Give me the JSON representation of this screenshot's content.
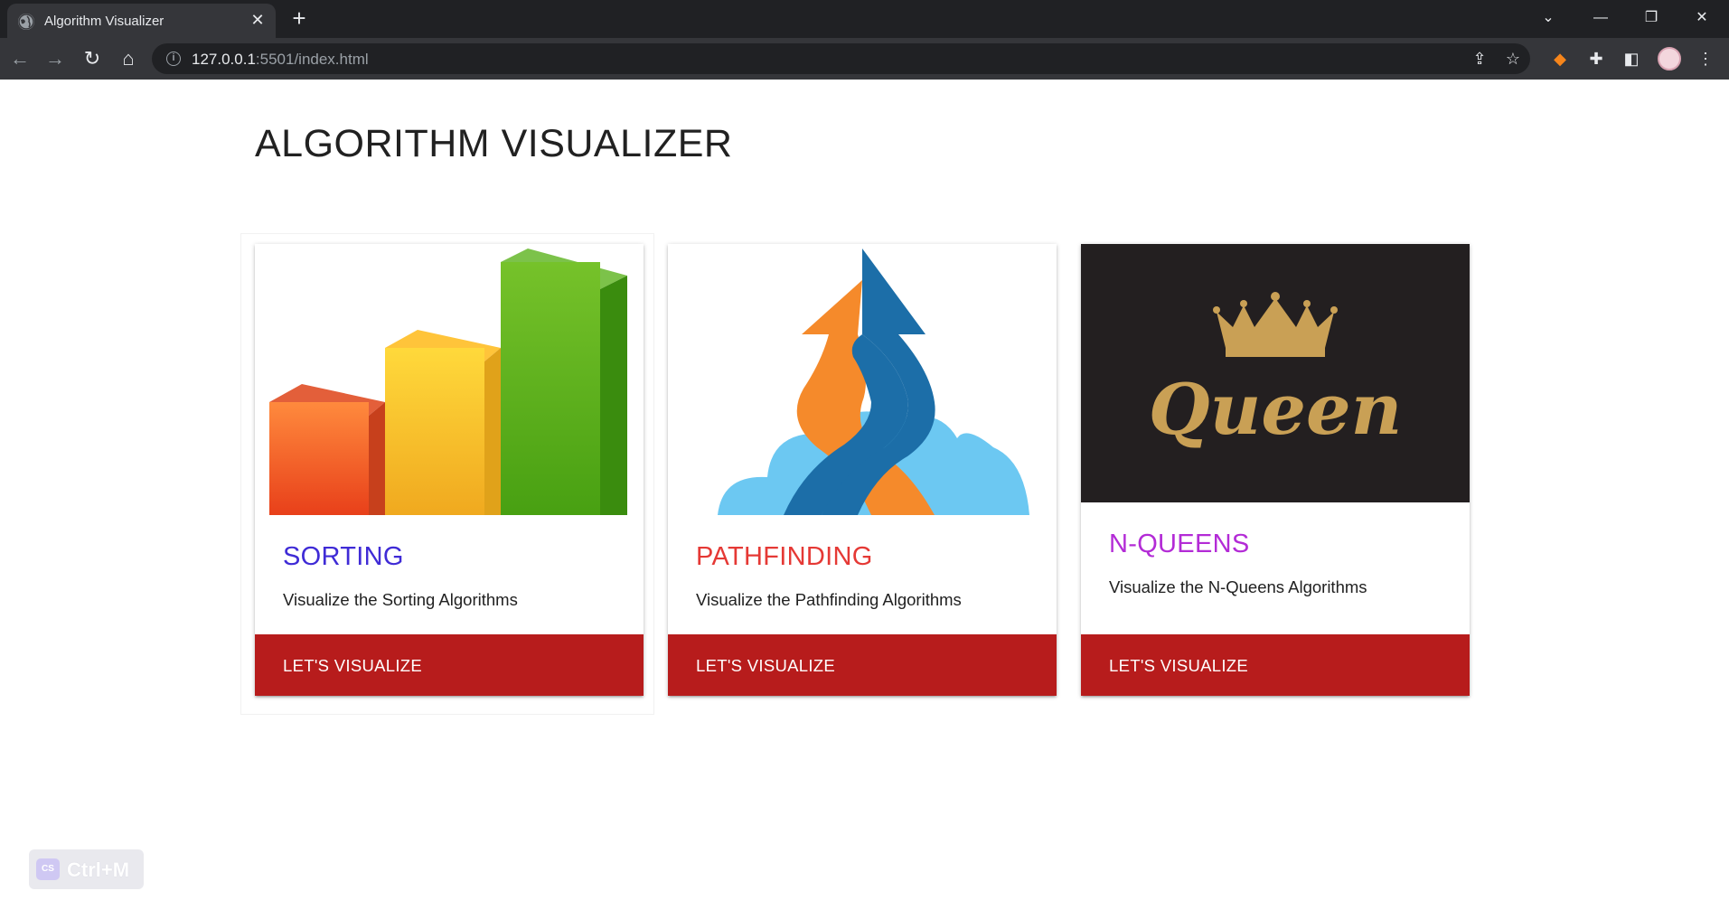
{
  "browser": {
    "tab_title": "Algorithm Visualizer",
    "tab_close": "✕",
    "new_tab": "+",
    "url_host": "127.0.0.1",
    "url_rest": ":5501/index.html"
  },
  "page": {
    "title": "ALGORITHM VISUALIZER"
  },
  "cards": [
    {
      "title": "SORTING",
      "description": "Visualize the Sorting Algorithms",
      "action": "LET'S VISUALIZE",
      "title_color": "#3f2bd6",
      "image": "bar-chart-illustration"
    },
    {
      "title": "PATHFINDING",
      "description": "Visualize the Pathfinding Algorithms",
      "action": "LET'S VISUALIZE",
      "title_color": "#e53935",
      "image": "intertwined-arrows-illustration"
    },
    {
      "title": "N-QUEENS",
      "description": "Visualize the N-Queens Algorithms",
      "action": "LET'S VISUALIZE",
      "title_color": "#b32bd6",
      "image": "queen-crown-illustration"
    }
  ],
  "overlay_badge": {
    "text": "Ctrl+M",
    "logo": "CS"
  },
  "colors": {
    "action_button": "#b71c1c",
    "chrome_dark": "#202124",
    "chrome_mid": "#35363a"
  }
}
